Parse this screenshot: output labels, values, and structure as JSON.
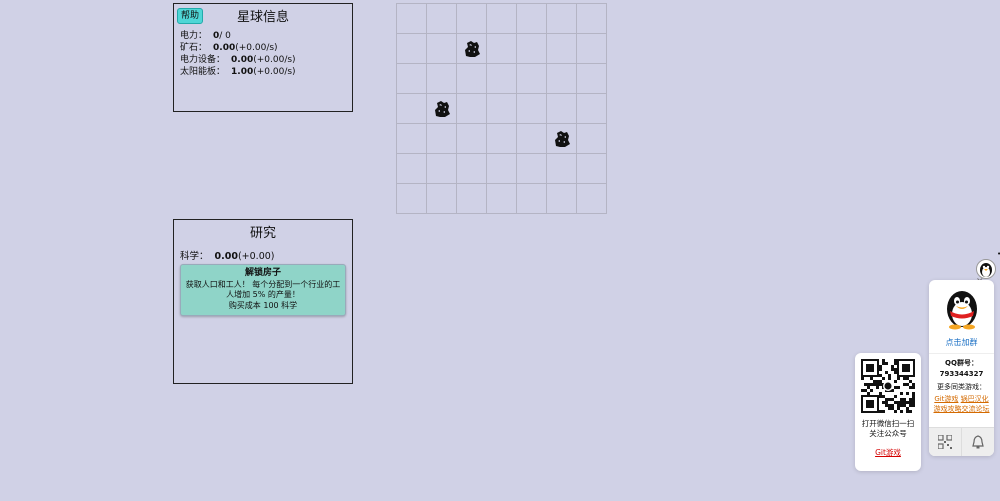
{
  "planet": {
    "help_label": "帮助",
    "title": "星球信息",
    "resources": [
      {
        "label": "电力：",
        "value": "0",
        "extra": "/ 0"
      },
      {
        "label": "矿石：",
        "value": "0.00",
        "extra": "(+0.00/s)"
      },
      {
        "label": "电力设备：",
        "value": "0.00",
        "extra": "(+0.00/s)"
      },
      {
        "label": "太阳能板：",
        "value": "1.00",
        "extra": "(+0.00/s)"
      }
    ]
  },
  "research": {
    "title": "研究",
    "science_label": "科学：",
    "science_value": "0.00",
    "science_rate": "(+0.00)",
    "upgrade": {
      "title": "解锁房子",
      "desc": "获取人口和工人！ 每个分配到一个行业的工人增加 5% 的产量！",
      "cost": "购买成本 100 科学"
    }
  },
  "map": {
    "rows": 7,
    "cols": 7,
    "rock_icon": "ore-rock-icon",
    "rocks": [
      [
        1,
        2
      ],
      [
        3,
        1
      ],
      [
        4,
        5
      ]
    ]
  },
  "qq": {
    "join_label": "点击加群",
    "num_label": "QQ群号：",
    "num": "793344327",
    "more_label": "更多同类游戏：",
    "links": [
      "Git游戏",
      "锅巴汉化",
      "游戏攻略交流论坛"
    ]
  },
  "wechat": {
    "line1": "打开微信扫一扫",
    "line2": "关注公众号",
    "link": "Git游戏"
  },
  "colors": {
    "background": "#d0d1e6",
    "help_button": "#4fd6d6",
    "upgrade_card": "#8fd4c8",
    "link_orange": "#d46a00",
    "link_red": "#d40000"
  }
}
